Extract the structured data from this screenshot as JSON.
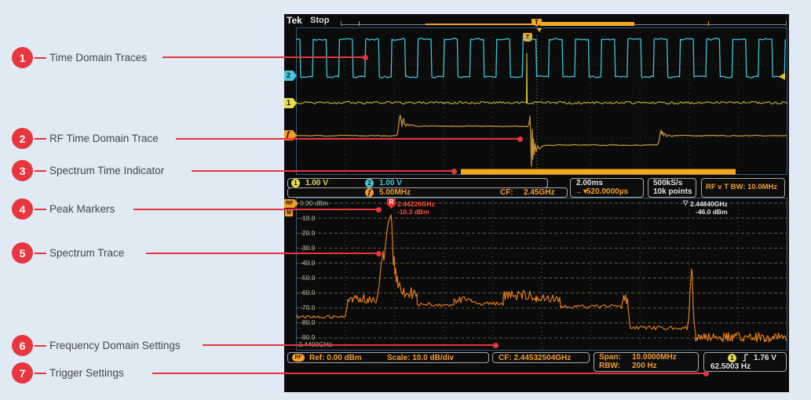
{
  "callouts": [
    {
      "num": "1",
      "label": "Time Domain Traces"
    },
    {
      "num": "2",
      "label": "RF Time Domain Trace"
    },
    {
      "num": "3",
      "label": "Spectrum Time Indicator"
    },
    {
      "num": "4",
      "label": "Peak Markers"
    },
    {
      "num": "5",
      "label": "Spectrum Trace"
    },
    {
      "num": "6",
      "label": "Frequency Domain Settings"
    },
    {
      "num": "7",
      "label": "Trigger Settings"
    }
  ],
  "scope": {
    "brand": "Tek",
    "acq_status": "Stop",
    "badges": {
      "ch1": "1",
      "ch2": "2",
      "rf_time": "f",
      "rf": "RF",
      "marker_m": "M",
      "trigger": "T"
    },
    "readouts": {
      "ch1_scale": "1.00 V",
      "ch2_scale": "1.00 V",
      "rf_freq_scale": "5.00MHz",
      "cf_label": "CF:",
      "cf_value": "2.45GHz",
      "timebase": "2.00ms",
      "trigger_arrows": "→▼",
      "trigger_time": "520.0000µs",
      "sample_rate": "500kS/s",
      "record_length": "10k points",
      "rf_vs_time_bw": "RF v T BW: 10.0MHz"
    },
    "spectrum": {
      "db_labels": [
        "0.00 dBm",
        "-10.0",
        "-20.0",
        "-30.0",
        "-40.0",
        "-50.0",
        "-60.0",
        "-70.0",
        "-80.0",
        "-90.0"
      ],
      "start_freq": "2.4400GHz",
      "ref_marker": {
        "flag": "R",
        "freq": "2.44226GHz",
        "amplitude": "-10.3 dBm"
      },
      "peak_marker": {
        "symbol": "▽",
        "freq": "2.44840GHz",
        "amplitude": "-46.0 dBm"
      }
    },
    "bottom": {
      "rf_badge": "RF",
      "ref_level": "Ref: 0.00 dBm",
      "scale": "Scale: 10.0 dB/div",
      "center_freq": "CF: 2.44532504GHz",
      "span_label": "Span:",
      "span_value": "10.0000MHz",
      "rbw_label": "RBW:",
      "rbw_value": "200 Hz",
      "trigger_source": "1",
      "trigger_level": "1.76 V",
      "trigger_freq": "62.5003 Hz"
    }
  },
  "colors": {
    "callout_red": "#e8353e",
    "ch1_yellow": "#e8db4a",
    "ch2_cyan": "#45c8dc",
    "rf_orange": "#f59b22",
    "marker_red": "#ff4a38"
  }
}
